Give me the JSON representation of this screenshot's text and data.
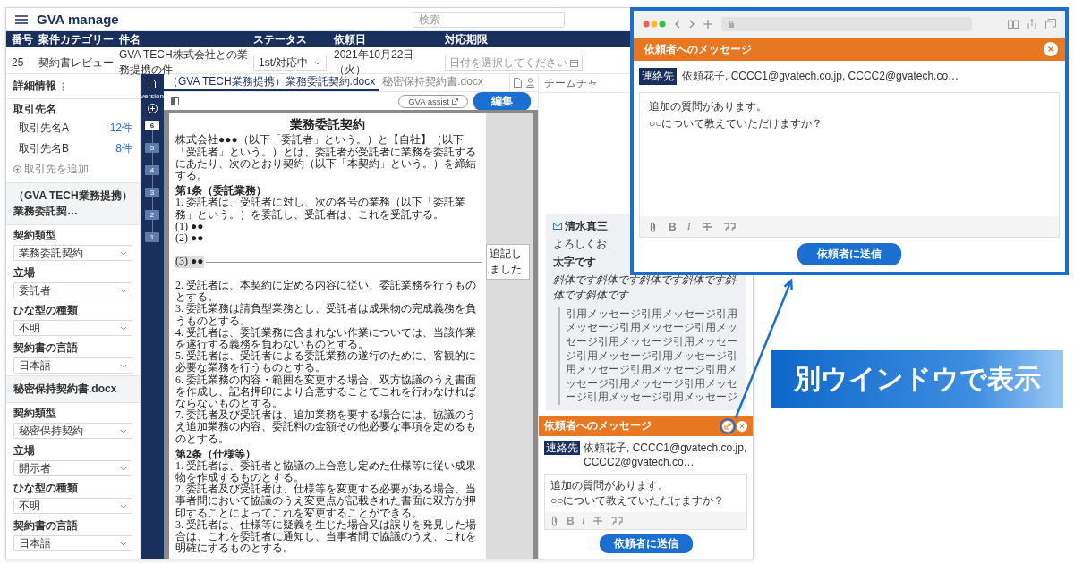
{
  "app": {
    "logo": "GVA manage",
    "search": {
      "placeholder": "検索"
    },
    "case_table": {
      "columns": [
        "番号",
        "案件カテゴリー",
        "件名",
        "ステータス",
        "依頼日",
        "対応期限"
      ],
      "row": {
        "number": "25",
        "category": "契約書レビュー",
        "title": "GVA TECH株式会社との業務提携の件",
        "status": "1st/対応中",
        "request_date": "2021年10月22日（火）",
        "deadline": {
          "placeholder": "日付を選択してください"
        }
      }
    },
    "sidebar": {
      "title": "詳細情報",
      "client_label": "取引先名",
      "clients": [
        {
          "name": "取引先名A",
          "count": "12件"
        },
        {
          "name": "取引先名B",
          "count": "8件"
        }
      ],
      "add_client": "取引先を追加",
      "sections": [
        {
          "title": "（GVA TECH業務提携）業務委託契…",
          "fields": [
            {
              "label": "契約類型",
              "value": "業務委託契約"
            },
            {
              "label": "立場",
              "value": "委託者"
            },
            {
              "label": "ひな型の種類",
              "value": "不明"
            },
            {
              "label": "契約書の言語",
              "value": "日本語"
            }
          ]
        },
        {
          "title": "秘密保持契約書.docx",
          "fields": [
            {
              "label": "契約類型",
              "value": "秘密保持契約"
            },
            {
              "label": "立場",
              "value": "開示者"
            },
            {
              "label": "ひな型の種類",
              "value": "不明"
            },
            {
              "label": "契約書の言語",
              "value": "日本語"
            }
          ]
        }
      ]
    },
    "doc_tabs": [
      {
        "label": "（GVA TECH業務提携）業務委託契約.docx",
        "selected": true
      },
      {
        "label": "秘密保持契約書.docx",
        "selected": false
      }
    ],
    "toolbar": {
      "assist": "GVA assist",
      "edit": "編集"
    },
    "versions": {
      "label": "version",
      "items": [
        {
          "label": "6",
          "selected": true
        },
        {
          "label": "5",
          "selected": false
        },
        {
          "label": "4",
          "selected": false
        },
        {
          "label": "3",
          "selected": false
        },
        {
          "label": "2",
          "selected": false
        },
        {
          "label": "1",
          "selected": false
        }
      ]
    },
    "document": {
      "title": "業務委託契約",
      "blocks": [
        {
          "kind": "paragraph",
          "text": "株式会社●●●（以下「委託者」という。）と【自社】（以下「受託者」という。）とは、委託者が受託者に業務を委託するにあたり、次のとおり契約（以下「本契約」という。）を締結する。"
        },
        {
          "kind": "heading",
          "text": "第1条（委託業務）"
        },
        {
          "kind": "paragraph",
          "text": "1. 委託者は、受託者に対し、次の各号の業務（以下「委託業務」という。）を委託し、受託者は、これを受託する。"
        },
        {
          "kind": "item",
          "text": "(1) ●●",
          "highlighted": false
        },
        {
          "kind": "item",
          "text": "(2) ●●",
          "highlighted": false
        },
        {
          "kind": "item",
          "text": "(3) ●●",
          "highlighted": true,
          "comment": "追記しました"
        },
        {
          "kind": "paragraph",
          "text": "2. 受託者は、本契約に定める内容に従い、委託業務を行うものとする。"
        },
        {
          "kind": "paragraph",
          "text": "3. 委託業務は請負型業務とし、受託者は成果物の完成義務を負うものとする。"
        },
        {
          "kind": "paragraph",
          "text": "4. 受託者は、委託業務に含まれない作業については、当該作業を遂行する義務を負わないものとする。"
        },
        {
          "kind": "paragraph",
          "text": "5. 受託者は、受託者による委託業務の遂行のために、客観的に必要な業務を行うものとする。"
        },
        {
          "kind": "paragraph",
          "text": "6. 委託業務の内容・範囲を変更する場合、双方協議のうえ書面を作成し、記名押印により合意することでこれを行わなければならないものとする。"
        },
        {
          "kind": "paragraph",
          "text": "7. 委託者及び受託者は、追加業務を要する場合には、協議のうえ追加業務の内容、委託料の金額その他必要な事項を定めるものとする。"
        },
        {
          "kind": "heading",
          "text": "第2条（仕様等）"
        },
        {
          "kind": "paragraph",
          "text": "1. 受託者は、委託者と協議の上合意し定めた仕様等に従い成果物を作成するものとする。"
        },
        {
          "kind": "paragraph",
          "text": "2. 委託者及び受託者は、仕様等を変更する必要がある場合、当事者間において協議のうえ変更点が記載された書面に双方が押印することによってこれを変更することができる。"
        },
        {
          "kind": "paragraph",
          "text": "3. 受託者は、仕様等に疑義を生じた場合又は誤りを発見した場合は、これを委託者に通知し、当事者間で協議のうえ、これを明確にするものとする。"
        }
      ]
    },
    "chat": {
      "tab": "チームチャ",
      "message": {
        "sender": "清水真三",
        "greeting": "よろしくお",
        "bold_line": "太字です",
        "italic_line": "斜体です斜体です斜体です斜体です斜体です斜体です",
        "quote": "引用メッセージ引用メッセージ引用メッセージ引用メッセージ引用メッセージ引用メッセージ引用メッセージ引用メッセージ引用メッセージ引用メッセージ引用メッセージ引用メッセージ引用メッセージ引用メッセージ引用メッセージ引用メッセージ"
      },
      "composer": {
        "title": "依頼者へのメッセージ",
        "contact_tag": "連絡先",
        "recipients": "依頼花子, CCCC1@gvatech.co.jp, CCCC2@gvatech.co…",
        "body": [
          "追加の質問があります。",
          "○○について教えていただけますか？"
        ],
        "format_buttons": [
          {
            "kind": "attach"
          },
          {
            "kind": "bold",
            "glyph": "B"
          },
          {
            "kind": "italic",
            "glyph": "I"
          },
          {
            "kind": "strike"
          },
          {
            "kind": "quote"
          }
        ],
        "send": "依頼者に送信"
      }
    }
  },
  "popup": {
    "title": "依頼者へのメッセージ",
    "contact_tag": "連絡先",
    "recipients": "依頼花子, CCCC1@gvatech.co.jp, CCCC2@gvatech.co…",
    "body": [
      "追加の質問があります。",
      "○○について教えていただけますか？"
    ],
    "format_buttons": [
      {
        "kind": "attach"
      },
      {
        "kind": "bold",
        "glyph": "B"
      },
      {
        "kind": "italic",
        "glyph": "I"
      },
      {
        "kind": "strike"
      },
      {
        "kind": "quote"
      }
    ],
    "send": "依頼者に送信"
  },
  "banner": {
    "text": "別ウインドウで表示"
  }
}
